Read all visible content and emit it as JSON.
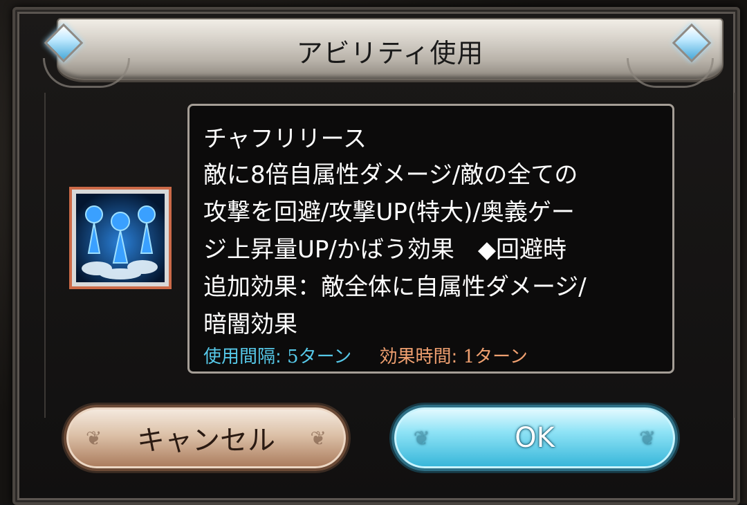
{
  "dialog": {
    "title": "アビリティ使用"
  },
  "ability": {
    "icon": "ability-icon-blue-figures",
    "name": "チャフリリース",
    "description_lines": [
      "敵に8倍自属性ダメージ/敵の全ての",
      "攻撃を回避/攻撃UP(特大)/奥義ゲー",
      "ジ上昇量UP/かばう効果　◆回避時",
      "追加効果：敵全体に自属性ダメージ/",
      "暗闇効果"
    ],
    "cooldown_label": "使用間隔: ",
    "cooldown_value": "5ターン",
    "duration_label": "効果時間: ",
    "duration_value": "1ターン"
  },
  "buttons": {
    "cancel_label": "キャンセル",
    "ok_label": "OK"
  },
  "colors": {
    "cooldown": "#56c8e8",
    "duration": "#f0a070",
    "icon_border": "#cc6a48"
  }
}
